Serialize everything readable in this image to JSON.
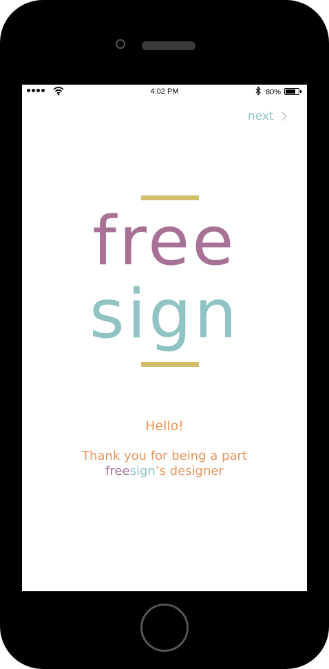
{
  "status_bar": {
    "time": "4:02 PM",
    "battery_percent_label": "80%",
    "battery_level": 0.8,
    "icons": [
      "signal-dots-icon",
      "wifi-icon",
      "bluetooth-icon",
      "battery-icon"
    ]
  },
  "nav": {
    "next_label": "next",
    "next_icon": "chevron-right-icon"
  },
  "logo": {
    "line1": "free",
    "line2": "sign"
  },
  "welcome": {
    "hello": "Hello!",
    "thanks_line1": "Thank you for being a part",
    "brand_free": "free",
    "brand_sign": "sign",
    "thanks_line2_suffix": "’s designer"
  },
  "colors": {
    "free": "#a87196",
    "sign": "#8fc3c4",
    "accent_bar": "#d1bd6a",
    "message": "#e8955a",
    "next": "#8fc3c4",
    "device": "#000000"
  }
}
